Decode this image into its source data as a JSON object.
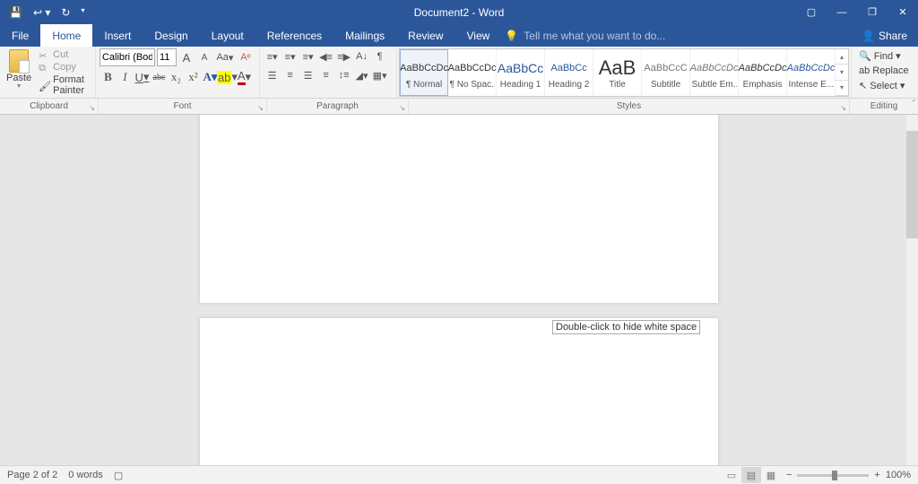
{
  "titlebar": {
    "title": "Document2 - Word"
  },
  "tabs": {
    "file": "File",
    "home": "Home",
    "insert": "Insert",
    "design": "Design",
    "layout": "Layout",
    "references": "References",
    "mailings": "Mailings",
    "review": "Review",
    "view": "View",
    "tellme_placeholder": "Tell me what you want to do...",
    "share": "Share"
  },
  "clipboard": {
    "paste": "Paste",
    "cut": "Cut",
    "copy": "Copy",
    "painter": "Format Painter",
    "label": "Clipboard"
  },
  "font": {
    "name": "Calibri (Body)",
    "size": "11",
    "grow": "A",
    "shrink": "A",
    "case": "Aa",
    "clear": "✎",
    "bold": "B",
    "italic": "I",
    "underline": "U",
    "strike": "abc",
    "sub": "x₂",
    "sup": "x²",
    "effects": "A",
    "highlight": "ab",
    "color": "A",
    "label": "Font"
  },
  "paragraph": {
    "label": "Paragraph"
  },
  "styles": {
    "label": "Styles",
    "items": [
      {
        "preview": "AaBbCcDc",
        "name": "¶ Normal",
        "color": "#333",
        "sel": true
      },
      {
        "preview": "AaBbCcDc",
        "name": "¶ No Spac...",
        "color": "#333"
      },
      {
        "preview": "AaBbCc",
        "name": "Heading 1",
        "color": "#2b579a",
        "big": true
      },
      {
        "preview": "AaBbCc",
        "name": "Heading 2",
        "color": "#2b579a"
      },
      {
        "preview": "AaB",
        "name": "Title",
        "color": "#333",
        "huge": true
      },
      {
        "preview": "AaBbCcC",
        "name": "Subtitle",
        "color": "#777"
      },
      {
        "preview": "AaBbCcDc",
        "name": "Subtle Em...",
        "color": "#777",
        "italic": true
      },
      {
        "preview": "AaBbCcDc",
        "name": "Emphasis",
        "color": "#333",
        "italic": true
      },
      {
        "preview": "AaBbCcDc",
        "name": "Intense E...",
        "color": "#2b579a",
        "italic": true
      }
    ]
  },
  "editing": {
    "find": "Find",
    "replace": "Replace",
    "select": "Select",
    "label": "Editing"
  },
  "tooltip": "Double-click to hide white space",
  "statusbar": {
    "page": "Page 2 of 2",
    "words": "0 words",
    "zoom": "100%"
  }
}
